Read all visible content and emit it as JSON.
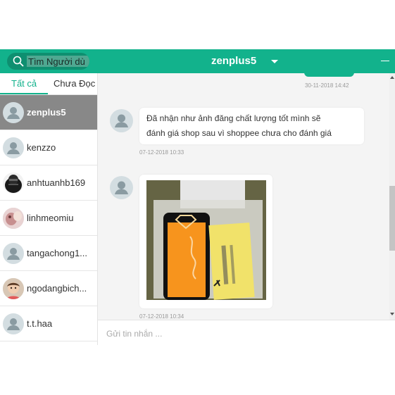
{
  "search": {
    "value": "Tìm Người dù"
  },
  "header": {
    "title": "zenplus5"
  },
  "tabs": [
    {
      "label": "Tất cả"
    },
    {
      "label": "Chưa Đọc"
    }
  ],
  "contacts": [
    {
      "name": "zenplus5"
    },
    {
      "name": "kenzzo"
    },
    {
      "name": "anhtuanhb169"
    },
    {
      "name": "linhmeomiu"
    },
    {
      "name": "tangachong1..."
    },
    {
      "name": "ngodangbich..."
    },
    {
      "name": "t.t.haa"
    }
  ],
  "messages": [
    {
      "time": "30-11-2018 14:42"
    },
    {
      "text_line1": "Đã nhận như ảnh đăng chất lượng tốt mình sẽ",
      "text_line2": "đánh giá shop sau vì shoppee chưa cho đánh giá",
      "time": "07-12-2018 10:33"
    },
    {
      "time": "07-12-2018 10:34"
    }
  ],
  "composer": {
    "placeholder": "Gửi tin nhắn ..."
  },
  "colors": {
    "accent": "#12b28c",
    "active_contact_bg": "#888888",
    "conversation_bg": "#f4f4f4"
  }
}
